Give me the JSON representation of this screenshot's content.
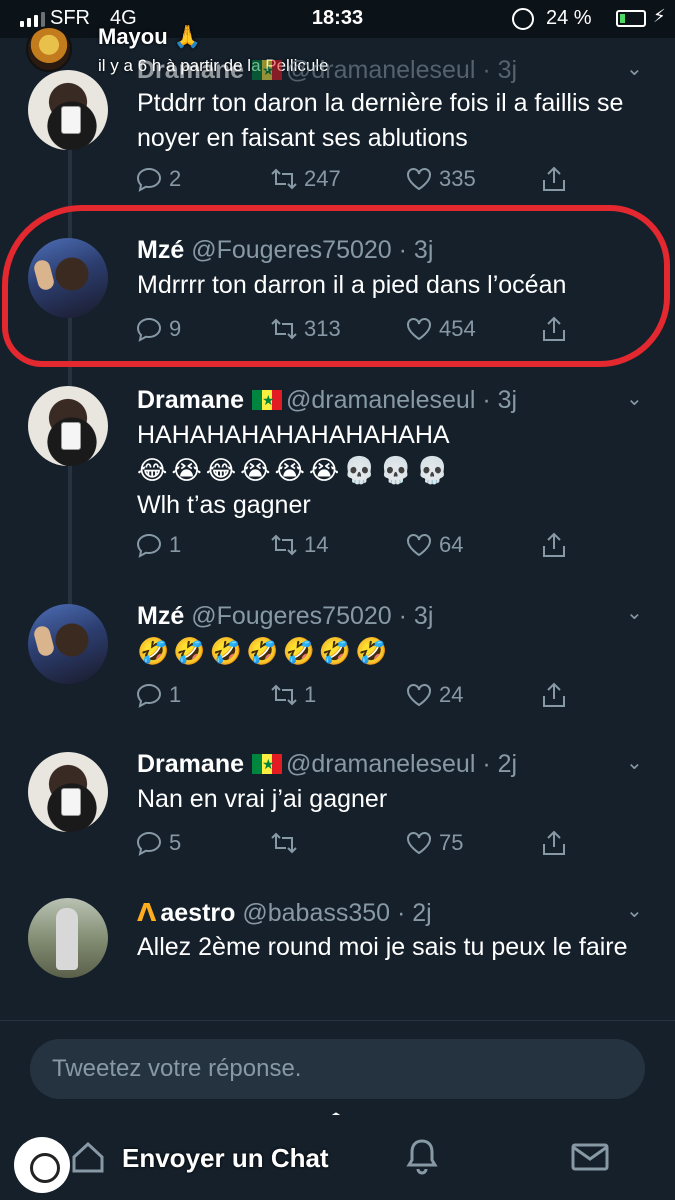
{
  "status_bar": {
    "carrier": "SFR",
    "network": "4G",
    "time": "18:33",
    "battery": "24 %",
    "battery_level": 0.24
  },
  "story": {
    "name": "Mayou 🙏",
    "subtitle": "il y a 6 h à partir de la Pellicule"
  },
  "tweets": [
    {
      "name": "Dramane",
      "flag": "SN",
      "handle": "@dramaneleseul · 3j",
      "text": "Ptddrr ton daron la dernière fois il a faillis se noyer en faisant ses ablutions",
      "replies": "2",
      "retweets": "247",
      "likes": "335"
    },
    {
      "name": "Mzé",
      "handle": "@Fougeres75020 · 3j",
      "text": "Mdrrrr ton darron il a pied dans l’océan",
      "replies": "9",
      "retweets": "313",
      "likes": "454"
    },
    {
      "name": "Dramane",
      "flag": "SN",
      "handle": "@dramaneleseul · 3j",
      "text": "HAHAHAHAHAHAHAHAHA",
      "emojis": "😂😭😂😭😭😭💀💀💀",
      "text2": "Wlh t’as gagner",
      "replies": "1",
      "retweets": "14",
      "likes": "64"
    },
    {
      "name": "Mzé",
      "handle": "@Fougeres75020 · 3j",
      "emojis": "🤣🤣🤣🤣🤣🤣🤣",
      "replies": "1",
      "retweets": "1",
      "likes": "24"
    },
    {
      "name": "Dramane",
      "flag": "SN",
      "handle": "@dramaneleseul · 2j",
      "text": "Nan en vrai j’ai gagner",
      "replies": "5",
      "retweets": "",
      "likes": "75"
    },
    {
      "name": "aestro",
      "logo": "M",
      "handle": "@babass350 · 2j",
      "text": "Allez 2ème round moi je sais tu peux le faire"
    }
  ],
  "reply": {
    "placeholder": "Tweetez votre réponse."
  },
  "snap": {
    "send_label": "Envoyer un Chat"
  },
  "colors": {
    "background": "#15202b",
    "muted": "#8899a6",
    "highlight": "#e3282f"
  }
}
